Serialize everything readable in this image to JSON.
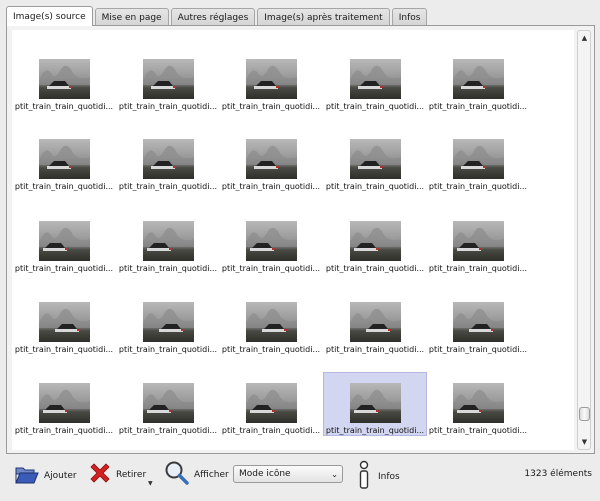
{
  "tabs": [
    {
      "label": "Image(s) source",
      "active": true
    },
    {
      "label": "Mise en page",
      "active": false
    },
    {
      "label": "Autres réglages",
      "active": false
    },
    {
      "label": "Image(s) après traitement",
      "active": false
    },
    {
      "label": "Infos",
      "active": false
    }
  ],
  "grid": {
    "caption": "ptit_train_train_quotidi...",
    "rows": 5,
    "cols": 5,
    "selected_index": 23
  },
  "toolbar": {
    "add_label": "Ajouter",
    "remove_label": "Retirer",
    "view_label": "Afficher",
    "mode_value": "Mode icône",
    "info_label": "Infos",
    "count_text": "1323 éléments"
  },
  "icons": {
    "add": "folder-open-icon",
    "remove": "red-x-icon",
    "view": "magnifier-icon",
    "info": "info-icon"
  },
  "colors": {
    "selection": "#d3d6f0",
    "remove_icon": "#d42020",
    "add_icon": "#2f4fa8"
  }
}
